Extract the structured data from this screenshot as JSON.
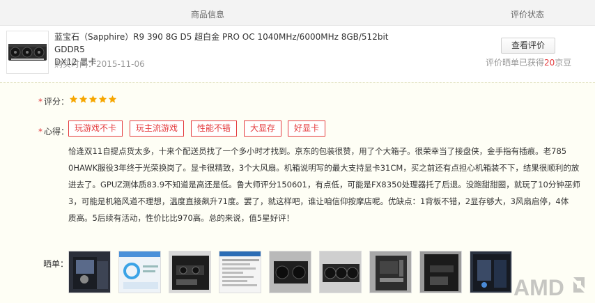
{
  "header": {
    "info_label": "商品信息",
    "status_label": "评价状态"
  },
  "product": {
    "title_line1": "蓝宝石（Sapphire）R9 390 8G D5 超白金 PRO OC 1040MHz/6000MHz 8GB/512bit GDDR5",
    "title_line2": "DX12 显卡",
    "purchase_date": "购买时间：2015-11-06"
  },
  "status": {
    "view_button": "查看评价",
    "reward_prefix": "评价晒单已获得",
    "reward_amount": "20",
    "reward_unit": "京豆"
  },
  "review": {
    "score_label": "评分：",
    "score_stars": 5,
    "required_mark": "*",
    "heart_label": "心得：",
    "tags": [
      "玩游戏不卡",
      "玩主流游戏",
      "性能不错",
      "大显存",
      "好显卡"
    ],
    "text_lines": [
      "恰逢双11自提点货太多，十来个配送员找了一个多小时才找到。京东的包装很赞，用了个大箱子。很荣幸当了接盘侠，金手指有插痕。老785",
      "0HAWK服役3年终于光荣换岗了。显卡很精致，3个大风扇。机箱说明写的最大支持显卡31CM，买之前还有点担心机箱装不下，结果很顺利的放",
      "进去了。GPUZ测体质83.9不知道是高还是低。鲁大师评分150601，有点低，可能是FX8350处理器托了后退。没跑甜甜圈，就玩了10分钟巫师",
      "3，可能是机箱风道不理想，温度直接飙升71度。罢了，就这样吧，谁让咱信仰按摩店呢。优缺点：1背板不错，2显存够大，3风扇启停，4体",
      "质高。5后续有活动，性价比比970高。总的来说，值5星好评！"
    ],
    "photos_label": "晒单："
  },
  "watermark": "AMD",
  "colors": {
    "accent": "#e4393c",
    "star": "#f6a600",
    "panel_bg": "#fefef5"
  }
}
